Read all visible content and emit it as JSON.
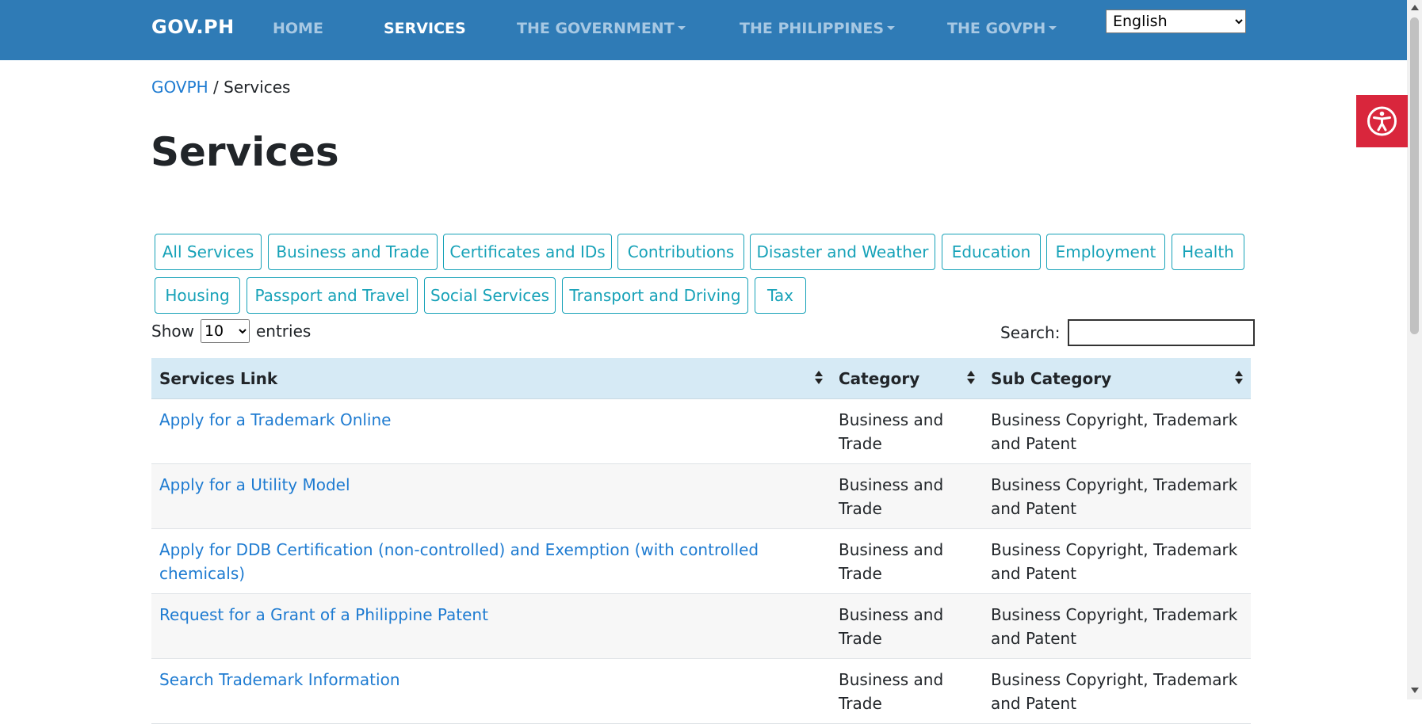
{
  "nav": {
    "brand": "GOV.PH",
    "items": [
      {
        "label": "HOME",
        "active": false,
        "dropdown": false
      },
      {
        "label": "SERVICES",
        "active": true,
        "dropdown": false
      },
      {
        "label": "THE GOVERNMENT",
        "active": false,
        "dropdown": true
      },
      {
        "label": "THE PHILIPPINES",
        "active": false,
        "dropdown": true
      },
      {
        "label": "THE GOVPH",
        "active": false,
        "dropdown": true
      }
    ],
    "language": "English"
  },
  "breadcrumb": {
    "root": "GOVPH",
    "separator": " / ",
    "current": "Services"
  },
  "page": {
    "title": "Services"
  },
  "filters": [
    "All Services",
    "Business and Trade",
    "Certificates and IDs",
    "Contributions",
    "Disaster and Weather",
    "Education",
    "Employment",
    "Health",
    "Housing",
    "Passport and Travel",
    "Social Services",
    "Transport and Driving",
    "Tax"
  ],
  "table_controls": {
    "show_label": "Show",
    "entries_value": "10",
    "entries_label": "entries",
    "search_label": "Search:",
    "search_value": ""
  },
  "table": {
    "headers": [
      "Services Link",
      "Category",
      "Sub Category"
    ],
    "rows": [
      {
        "link": "Apply for a Trademark Online",
        "category": "Business and Trade",
        "sub_category": "Business Copyright, Trademark and Patent"
      },
      {
        "link": "Apply for a Utility Model",
        "category": "Business and Trade",
        "sub_category": "Business Copyright, Trademark and Patent"
      },
      {
        "link": "Apply for DDB Certification (non-controlled) and Exemption (with controlled chemicals)",
        "category": "Business and Trade",
        "sub_category": "Business Copyright, Trademark and Patent"
      },
      {
        "link": "Request for a Grant of a Philippine Patent",
        "category": "Business and Trade",
        "sub_category": "Business Copyright, Trademark and Patent"
      },
      {
        "link": "Search Trademark Information",
        "category": "Business and Trade",
        "sub_category": "Business Copyright, Trademark and Patent"
      }
    ]
  },
  "icons": {
    "accessibility": "accessibility-icon",
    "sort": "sort-icon",
    "dropdown": "caret-down-icon"
  },
  "colors": {
    "header_bg": "#2f7bb6",
    "link": "#1e7bd1",
    "filter_accent": "#17a2b8",
    "table_head_bg": "#d6eaf5",
    "accessibility_bg": "#d9263c"
  }
}
